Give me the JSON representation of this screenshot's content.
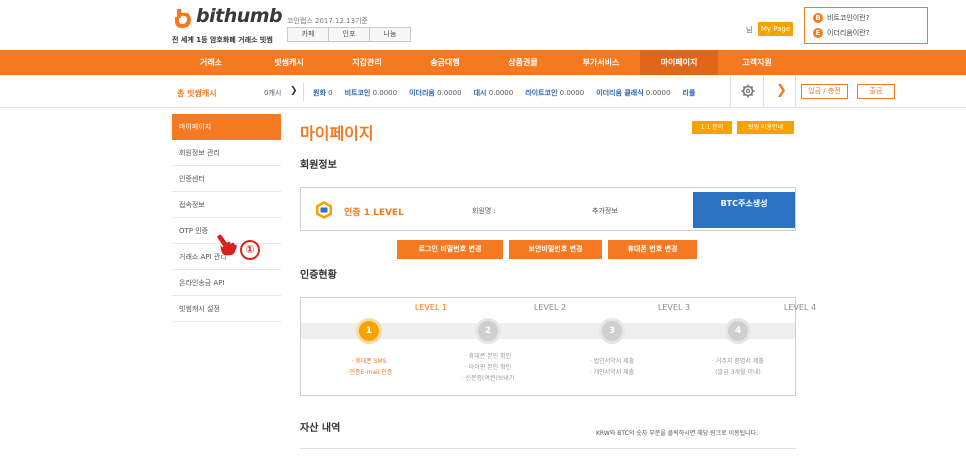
{
  "header": {
    "logo_text": "bithumb",
    "slogan": "전 세계 1등 암호화폐 거래소 빗썸",
    "coin_date": "코인랩스 2017.12.13기준",
    "top_tabs": [
      "카페",
      "인포",
      "나눔"
    ],
    "user_suffix": "님",
    "mypage_button": "My Page",
    "info_links": [
      {
        "icon": "B",
        "label": "비트코인이란?"
      },
      {
        "icon": "E",
        "label": "이더리움이란?"
      }
    ]
  },
  "nav": {
    "items": [
      "거래소",
      "빗썸캐시",
      "지갑관리",
      "송금대행",
      "상품권몰",
      "부가서비스",
      "마이페이지",
      "고객지원"
    ],
    "active_index": 6
  },
  "ticker": {
    "total_label": "총 빗썸캐시",
    "total_value": "0캐시",
    "items": [
      {
        "name": "원화",
        "value": "0"
      },
      {
        "name": "비트코인",
        "value": "0.0000"
      },
      {
        "name": "이더리움",
        "value": "0.0000"
      },
      {
        "name": "대시",
        "value": "0.0000"
      },
      {
        "name": "라이트코인",
        "value": "0.0000"
      },
      {
        "name": "이더리움 클래식",
        "value": "0.0000"
      },
      {
        "name": "리플",
        "value": ""
      }
    ],
    "deposit_button": "입금 / 충전",
    "withdraw_button": "출금"
  },
  "sidebar": {
    "items": [
      "마이페이지",
      "회원정보 관리",
      "인증센터",
      "접속정보",
      "OTP 인증",
      "거래소 API 관리",
      "온라인송금 API",
      "빗썸캐시 설정"
    ],
    "active_index": 0
  },
  "annotation": {
    "step_marker": "①"
  },
  "main": {
    "title": "마이페이지",
    "inquiry_button": "1:1 문의",
    "guide_button": "빗썸 이용안내",
    "member_section_title": "회원정보",
    "level_text": "인증 1 LEVEL",
    "member_name_label": "회원명 :",
    "extra_info_label": "추가정보",
    "btc_address_button": "BTC주소생성",
    "action_buttons": [
      "로그인 비밀번호 변경",
      "보안비밀번호 변경",
      "휴대폰 번호 변경"
    ],
    "auth_section_title": "인증현황",
    "levels": [
      {
        "label": "LEVEL 1",
        "number": "1",
        "requirements": [
          "· 휴대폰 SMS",
          "· 인증E-mail 인증"
        ],
        "active": true
      },
      {
        "label": "LEVEL 2",
        "number": "2",
        "requirements": [
          "· 휴대폰 본인 확인",
          "· 아이핀 본인 확인",
          "· 신분증(여권)보내기"
        ],
        "active": false
      },
      {
        "label": "LEVEL 3",
        "number": "3",
        "requirements": [
          "· 법인서약서 제출",
          "· 개인서약서 제출"
        ],
        "active": false
      },
      {
        "label": "LEVEL 4",
        "number": "4",
        "requirements": [
          "· 거주지 증명서 제출",
          "(발급 3개월 이내)"
        ],
        "active": false
      }
    ],
    "asset_section_title": "자산 내역",
    "asset_note": "KRW와 BTC의 숫자 부분을 클릭하시면 해당 링크로 이동됩니다."
  },
  "colors": {
    "brand_orange": "#f47920",
    "accent_yellow": "#f5a300",
    "btc_blue": "#2b73c2"
  }
}
